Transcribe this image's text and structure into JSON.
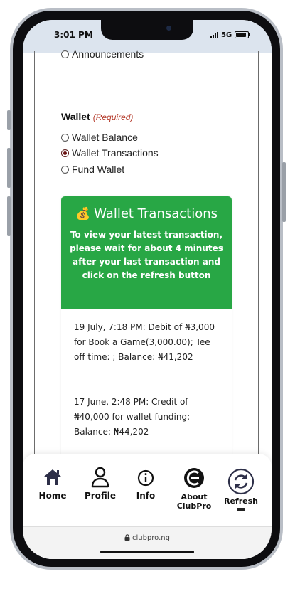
{
  "status": {
    "time": "3:01 PM",
    "network": "5G"
  },
  "form": {
    "prev_option": "Announcements",
    "wallet_label": "Wallet",
    "required_label": "(Required)",
    "options": [
      {
        "label": "Wallet Balance",
        "checked": false
      },
      {
        "label": "Wallet Transactions",
        "checked": true
      },
      {
        "label": "Fund Wallet",
        "checked": false
      }
    ]
  },
  "card": {
    "icon": "💰",
    "title": "Wallet Transactions",
    "note": "To view your latest transaction, please wait for about 4 minutes after your last transaction and click on the refresh button",
    "transactions": [
      "19 July, 7:18 PM: Debit of ₦3,000 for Book a Game(3,000.00); Tee off time: ; Balance: ₦41,202",
      "17 June, 2:48 PM: Credit of ₦40,000 for wallet funding; Balance: ₦44,202"
    ],
    "header_color": "#28a745"
  },
  "tabs": {
    "home": "Home",
    "profile": "Profile",
    "info": "Info",
    "about_line1": "About",
    "about_line2": "ClubPro",
    "refresh": "Refresh"
  },
  "browser": {
    "url": "clubpro.ng"
  }
}
